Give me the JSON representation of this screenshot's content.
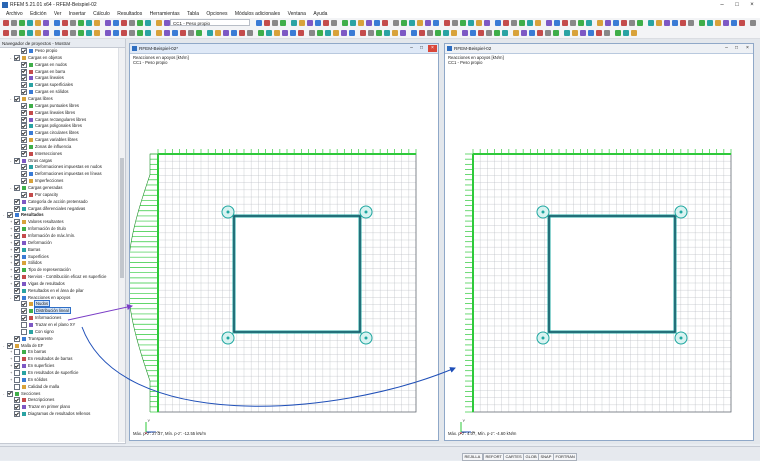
{
  "app": {
    "title": "RFEM 5.21.01 x64 - RFEM-Beispiel-02",
    "window_controls": [
      "–",
      "□",
      "×"
    ]
  },
  "menu": [
    "Archivo",
    "Edición",
    "Ver",
    "Insertar",
    "Cálculo",
    "Resultados",
    "Herramientas",
    "Tabla",
    "Opciones",
    "Módulos adicionales",
    "Ventana",
    "Ayuda"
  ],
  "toolbar": {
    "load_case_combo": "CC1 - Peso propio"
  },
  "navigator": {
    "title": "Navegador de proyectos - Mostrar",
    "items": [
      {
        "label": "Peso propio",
        "level": 2,
        "checked": true,
        "expander": ""
      },
      {
        "label": "Cargas en objetos",
        "level": 1,
        "checked": true,
        "expander": "-"
      },
      {
        "label": "Cargas en nudos",
        "level": 2,
        "checked": true,
        "expander": ""
      },
      {
        "label": "Cargas en barra",
        "level": 2,
        "checked": true,
        "expander": ""
      },
      {
        "label": "Cargas lineales",
        "level": 2,
        "checked": true,
        "expander": ""
      },
      {
        "label": "Cargas superficiales",
        "level": 2,
        "checked": true,
        "expander": ""
      },
      {
        "label": "Cargas en sólidos",
        "level": 2,
        "checked": true,
        "expander": ""
      },
      {
        "label": "Cargas libres",
        "level": 1,
        "checked": true,
        "expander": "-"
      },
      {
        "label": "Cargas puntuales libres",
        "level": 2,
        "checked": true,
        "expander": ""
      },
      {
        "label": "Cargas lineales libres",
        "level": 2,
        "checked": true,
        "expander": ""
      },
      {
        "label": "Cargas rectangulares libres",
        "level": 2,
        "checked": true,
        "expander": ""
      },
      {
        "label": "Cargas poligonales libres",
        "level": 2,
        "checked": true,
        "expander": ""
      },
      {
        "label": "Cargas circulares libres",
        "level": 2,
        "checked": true,
        "expander": ""
      },
      {
        "label": "Cargas variables libres",
        "level": 2,
        "checked": true,
        "expander": ""
      },
      {
        "label": "Zonas de influencia",
        "level": 2,
        "checked": true,
        "expander": ""
      },
      {
        "label": "Intersecciones",
        "level": 2,
        "checked": true,
        "expander": ""
      },
      {
        "label": "Otras cargas",
        "level": 1,
        "checked": true,
        "expander": "-"
      },
      {
        "label": "Deformaciones impuestas en nudos",
        "level": 2,
        "checked": true,
        "expander": ""
      },
      {
        "label": "Deformaciones impuestas en líneas",
        "level": 2,
        "checked": true,
        "expander": ""
      },
      {
        "label": "Imperfecciones",
        "level": 2,
        "checked": true,
        "expander": ""
      },
      {
        "label": "Cargas generadas",
        "level": 1,
        "checked": true,
        "expander": "-"
      },
      {
        "label": "Por capacity",
        "level": 2,
        "checked": true,
        "expander": ""
      },
      {
        "label": "Categoría de acción pretensado",
        "level": 1,
        "checked": true,
        "expander": ""
      },
      {
        "label": "Cargas diferenciales negativas",
        "level": 1,
        "checked": true,
        "expander": ""
      },
      {
        "label": "Resultados",
        "level": 0,
        "checked": true,
        "expander": "-",
        "bold": true
      },
      {
        "label": "Valores resultantes",
        "level": 1,
        "checked": true,
        "expander": "+"
      },
      {
        "label": "Información de título",
        "level": 1,
        "checked": true,
        "expander": "+"
      },
      {
        "label": "Información de máx./mín.",
        "level": 1,
        "checked": true,
        "expander": "+"
      },
      {
        "label": "Deformación",
        "level": 1,
        "checked": true,
        "expander": "+"
      },
      {
        "label": "Barras",
        "level": 1,
        "checked": true,
        "expander": "+"
      },
      {
        "label": "Superficies",
        "level": 1,
        "checked": true,
        "expander": "+"
      },
      {
        "label": "Sólidos",
        "level": 1,
        "checked": true,
        "expander": "+"
      },
      {
        "label": "Tipo de representación",
        "level": 1,
        "checked": true,
        "expander": "+"
      },
      {
        "label": "Nervios - Contribución eficaz en superficie",
        "level": 1,
        "checked": true,
        "expander": "+"
      },
      {
        "label": "Vigas de resultados",
        "level": 1,
        "checked": true,
        "expander": "+"
      },
      {
        "label": "Resultados en el área de pilar",
        "level": 1,
        "checked": true,
        "expander": ""
      },
      {
        "label": "Reacciones en apoyos",
        "level": 1,
        "checked": true,
        "expander": "-"
      },
      {
        "label": "Nudos",
        "level": 2,
        "checked": true,
        "expander": "",
        "selected": true
      },
      {
        "label": "Distribución lineal",
        "level": 2,
        "checked": true,
        "expander": "",
        "selected": true
      },
      {
        "label": "Informaciones",
        "level": 2,
        "checked": true,
        "expander": ""
      },
      {
        "label": "Trazar en el plano XY",
        "level": 2,
        "checked": false,
        "expander": ""
      },
      {
        "label": "Con signo",
        "level": 2,
        "checked": false,
        "expander": ""
      },
      {
        "label": "Transparente",
        "level": 1,
        "checked": true,
        "expander": ""
      },
      {
        "label": "Malla de EF",
        "level": 0,
        "checked": true,
        "expander": "-"
      },
      {
        "label": "En barras",
        "level": 1,
        "checked": false,
        "expander": "+"
      },
      {
        "label": "En resultados de barras",
        "level": 1,
        "checked": false,
        "expander": "+"
      },
      {
        "label": "En superficies",
        "level": 1,
        "checked": true,
        "expander": "+"
      },
      {
        "label": "En resultados de superficie",
        "level": 1,
        "checked": false,
        "expander": "+"
      },
      {
        "label": "En sólidos",
        "level": 1,
        "checked": false,
        "expander": "+"
      },
      {
        "label": "Calidad de malla",
        "level": 1,
        "checked": false,
        "expander": ""
      },
      {
        "label": "Secciones",
        "level": 0,
        "checked": true,
        "expander": "-"
      },
      {
        "label": "Descripciones",
        "level": 1,
        "checked": true,
        "expander": ""
      },
      {
        "label": "Trazar en primer plano",
        "level": 1,
        "checked": true,
        "expander": ""
      },
      {
        "label": "Diagramas de resultados rellenos",
        "level": 1,
        "checked": true,
        "expander": ""
      }
    ],
    "tabs": [
      "Datos",
      "Mostrar",
      "Vistas",
      "Resultados"
    ]
  },
  "windows": [
    {
      "title": "RFEM-Beispiel-02*",
      "caption1": "Reacciones en apoyos [kN/m]",
      "caption2": "CC1 - Peso propio",
      "footer": "Máx. p-z': 27.37, Mín. p-z': -12.55 kN/m",
      "axis_labels": [
        "X",
        "Y",
        "Z"
      ]
    },
    {
      "title": "RFEM-Beispiel-02",
      "caption1": "Reacciones en apoyos [kN/m]",
      "caption2": "CC1 - Peso propio",
      "footer": "Máx. p-z': 4.07, Mín. p-z': -4.60 kN/m",
      "axis_labels": [
        "X",
        "Y",
        "Z"
      ]
    }
  ],
  "statusbar": [
    "REJILLA",
    "REFORT",
    "CARTES",
    "GLOB",
    "SNAP",
    "FORTRAN"
  ],
  "colors": {
    "accent": "#2f6fc7",
    "diagram_green": "#2ec93a",
    "mesh_gray": "#9aa0a8",
    "support_teal": "#1fa7a0",
    "arrow_purple": "#7a3dc6",
    "arrow_blue": "#1f4fb8"
  }
}
